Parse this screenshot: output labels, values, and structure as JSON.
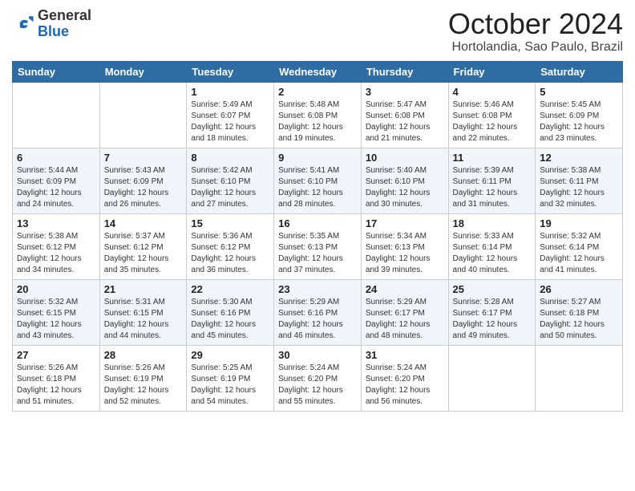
{
  "logo": {
    "general": "General",
    "blue": "Blue"
  },
  "header": {
    "month": "October 2024",
    "location": "Hortolandia, Sao Paulo, Brazil"
  },
  "days_of_week": [
    "Sunday",
    "Monday",
    "Tuesday",
    "Wednesday",
    "Thursday",
    "Friday",
    "Saturday"
  ],
  "weeks": [
    [
      {
        "day": "",
        "sunrise": "",
        "sunset": "",
        "daylight": ""
      },
      {
        "day": "",
        "sunrise": "",
        "sunset": "",
        "daylight": ""
      },
      {
        "day": "1",
        "sunrise": "Sunrise: 5:49 AM",
        "sunset": "Sunset: 6:07 PM",
        "daylight": "Daylight: 12 hours and 18 minutes."
      },
      {
        "day": "2",
        "sunrise": "Sunrise: 5:48 AM",
        "sunset": "Sunset: 6:08 PM",
        "daylight": "Daylight: 12 hours and 19 minutes."
      },
      {
        "day": "3",
        "sunrise": "Sunrise: 5:47 AM",
        "sunset": "Sunset: 6:08 PM",
        "daylight": "Daylight: 12 hours and 21 minutes."
      },
      {
        "day": "4",
        "sunrise": "Sunrise: 5:46 AM",
        "sunset": "Sunset: 6:08 PM",
        "daylight": "Daylight: 12 hours and 22 minutes."
      },
      {
        "day": "5",
        "sunrise": "Sunrise: 5:45 AM",
        "sunset": "Sunset: 6:09 PM",
        "daylight": "Daylight: 12 hours and 23 minutes."
      }
    ],
    [
      {
        "day": "6",
        "sunrise": "Sunrise: 5:44 AM",
        "sunset": "Sunset: 6:09 PM",
        "daylight": "Daylight: 12 hours and 24 minutes."
      },
      {
        "day": "7",
        "sunrise": "Sunrise: 5:43 AM",
        "sunset": "Sunset: 6:09 PM",
        "daylight": "Daylight: 12 hours and 26 minutes."
      },
      {
        "day": "8",
        "sunrise": "Sunrise: 5:42 AM",
        "sunset": "Sunset: 6:10 PM",
        "daylight": "Daylight: 12 hours and 27 minutes."
      },
      {
        "day": "9",
        "sunrise": "Sunrise: 5:41 AM",
        "sunset": "Sunset: 6:10 PM",
        "daylight": "Daylight: 12 hours and 28 minutes."
      },
      {
        "day": "10",
        "sunrise": "Sunrise: 5:40 AM",
        "sunset": "Sunset: 6:10 PM",
        "daylight": "Daylight: 12 hours and 30 minutes."
      },
      {
        "day": "11",
        "sunrise": "Sunrise: 5:39 AM",
        "sunset": "Sunset: 6:11 PM",
        "daylight": "Daylight: 12 hours and 31 minutes."
      },
      {
        "day": "12",
        "sunrise": "Sunrise: 5:38 AM",
        "sunset": "Sunset: 6:11 PM",
        "daylight": "Daylight: 12 hours and 32 minutes."
      }
    ],
    [
      {
        "day": "13",
        "sunrise": "Sunrise: 5:38 AM",
        "sunset": "Sunset: 6:12 PM",
        "daylight": "Daylight: 12 hours and 34 minutes."
      },
      {
        "day": "14",
        "sunrise": "Sunrise: 5:37 AM",
        "sunset": "Sunset: 6:12 PM",
        "daylight": "Daylight: 12 hours and 35 minutes."
      },
      {
        "day": "15",
        "sunrise": "Sunrise: 5:36 AM",
        "sunset": "Sunset: 6:12 PM",
        "daylight": "Daylight: 12 hours and 36 minutes."
      },
      {
        "day": "16",
        "sunrise": "Sunrise: 5:35 AM",
        "sunset": "Sunset: 6:13 PM",
        "daylight": "Daylight: 12 hours and 37 minutes."
      },
      {
        "day": "17",
        "sunrise": "Sunrise: 5:34 AM",
        "sunset": "Sunset: 6:13 PM",
        "daylight": "Daylight: 12 hours and 39 minutes."
      },
      {
        "day": "18",
        "sunrise": "Sunrise: 5:33 AM",
        "sunset": "Sunset: 6:14 PM",
        "daylight": "Daylight: 12 hours and 40 minutes."
      },
      {
        "day": "19",
        "sunrise": "Sunrise: 5:32 AM",
        "sunset": "Sunset: 6:14 PM",
        "daylight": "Daylight: 12 hours and 41 minutes."
      }
    ],
    [
      {
        "day": "20",
        "sunrise": "Sunrise: 5:32 AM",
        "sunset": "Sunset: 6:15 PM",
        "daylight": "Daylight: 12 hours and 43 minutes."
      },
      {
        "day": "21",
        "sunrise": "Sunrise: 5:31 AM",
        "sunset": "Sunset: 6:15 PM",
        "daylight": "Daylight: 12 hours and 44 minutes."
      },
      {
        "day": "22",
        "sunrise": "Sunrise: 5:30 AM",
        "sunset": "Sunset: 6:16 PM",
        "daylight": "Daylight: 12 hours and 45 minutes."
      },
      {
        "day": "23",
        "sunrise": "Sunrise: 5:29 AM",
        "sunset": "Sunset: 6:16 PM",
        "daylight": "Daylight: 12 hours and 46 minutes."
      },
      {
        "day": "24",
        "sunrise": "Sunrise: 5:29 AM",
        "sunset": "Sunset: 6:17 PM",
        "daylight": "Daylight: 12 hours and 48 minutes."
      },
      {
        "day": "25",
        "sunrise": "Sunrise: 5:28 AM",
        "sunset": "Sunset: 6:17 PM",
        "daylight": "Daylight: 12 hours and 49 minutes."
      },
      {
        "day": "26",
        "sunrise": "Sunrise: 5:27 AM",
        "sunset": "Sunset: 6:18 PM",
        "daylight": "Daylight: 12 hours and 50 minutes."
      }
    ],
    [
      {
        "day": "27",
        "sunrise": "Sunrise: 5:26 AM",
        "sunset": "Sunset: 6:18 PM",
        "daylight": "Daylight: 12 hours and 51 minutes."
      },
      {
        "day": "28",
        "sunrise": "Sunrise: 5:26 AM",
        "sunset": "Sunset: 6:19 PM",
        "daylight": "Daylight: 12 hours and 52 minutes."
      },
      {
        "day": "29",
        "sunrise": "Sunrise: 5:25 AM",
        "sunset": "Sunset: 6:19 PM",
        "daylight": "Daylight: 12 hours and 54 minutes."
      },
      {
        "day": "30",
        "sunrise": "Sunrise: 5:24 AM",
        "sunset": "Sunset: 6:20 PM",
        "daylight": "Daylight: 12 hours and 55 minutes."
      },
      {
        "day": "31",
        "sunrise": "Sunrise: 5:24 AM",
        "sunset": "Sunset: 6:20 PM",
        "daylight": "Daylight: 12 hours and 56 minutes."
      },
      {
        "day": "",
        "sunrise": "",
        "sunset": "",
        "daylight": ""
      },
      {
        "day": "",
        "sunrise": "",
        "sunset": "",
        "daylight": ""
      }
    ]
  ]
}
